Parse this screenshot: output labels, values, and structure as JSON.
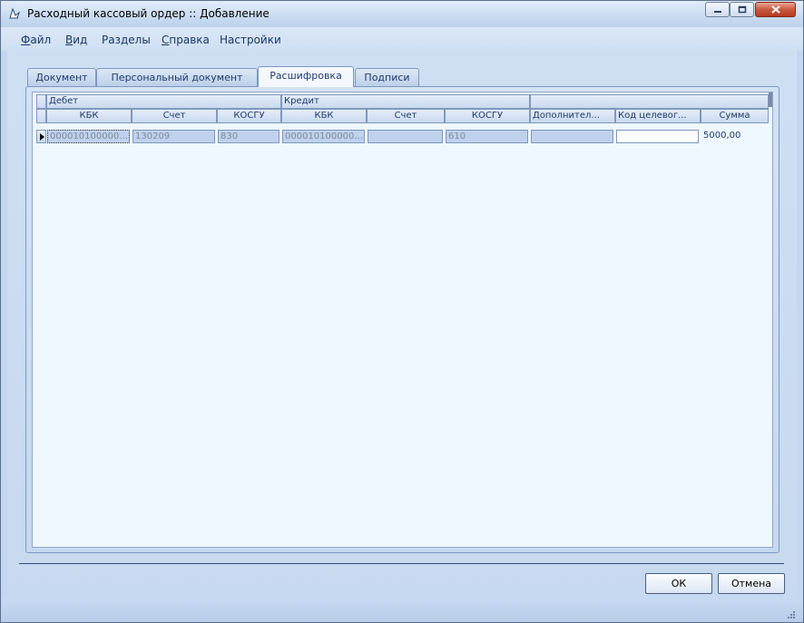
{
  "window": {
    "title": "Расходный кассовый ордер :: Добавление",
    "icon": "document-edit-icon"
  },
  "menu": {
    "items": [
      {
        "first": "Ф",
        "rest": "айл"
      },
      {
        "first": "В",
        "rest": "ид"
      },
      {
        "first": "",
        "rest": "Разделы"
      },
      {
        "first": "С",
        "rest": "правка"
      },
      {
        "first": "",
        "rest": "Настройки"
      }
    ]
  },
  "tabs": [
    {
      "label": "Документ"
    },
    {
      "label": "Персональный документ"
    },
    {
      "label": "Расшифровка",
      "active": true
    },
    {
      "label": "Подписи"
    }
  ],
  "grid": {
    "bands": [
      "Дебет",
      "Кредит",
      ""
    ],
    "columns": [
      "КБК",
      "Счет",
      "КОСГУ",
      "КБК",
      "Счет",
      "КОСГУ",
      "Дополнител...",
      "Код целевог...",
      "Сумма"
    ],
    "rows": [
      [
        "000010100000...",
        "130209",
        "830",
        "000010100000...",
        "",
        "610",
        "",
        "",
        "5000,00"
      ]
    ]
  },
  "buttons": {
    "ok": "ОК",
    "cancel": "Отмена"
  },
  "colors": {
    "accent": "#1f3a6e",
    "frame": "#c5d7ef",
    "grid_background": "#eef8fe",
    "close_button": "#c75a3f"
  }
}
